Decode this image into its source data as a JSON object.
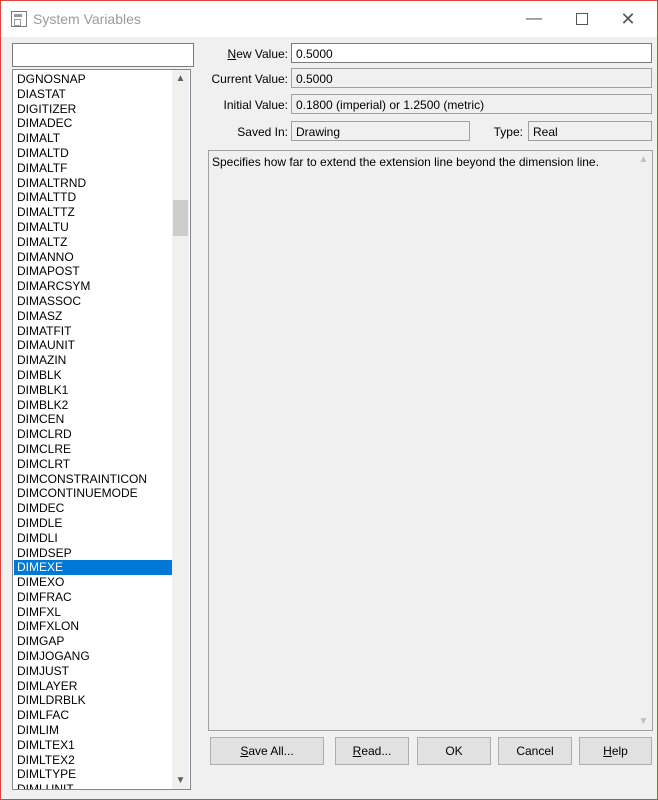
{
  "window": {
    "title": "System Variables"
  },
  "titlebar": {
    "minimize": "—",
    "close": "✕"
  },
  "search": {
    "value": ""
  },
  "list": {
    "items": [
      "DGNOSNAP",
      "DIASTAT",
      "DIGITIZER",
      "DIMADEC",
      "DIMALT",
      "DIMALTD",
      "DIMALTF",
      "DIMALTRND",
      "DIMALTTD",
      "DIMALTTZ",
      "DIMALTU",
      "DIMALTZ",
      "DIMANNO",
      "DIMAPOST",
      "DIMARCSYM",
      "DIMASSOC",
      "DIMASZ",
      "DIMATFIT",
      "DIMAUNIT",
      "DIMAZIN",
      "DIMBLK",
      "DIMBLK1",
      "DIMBLK2",
      "DIMCEN",
      "DIMCLRD",
      "DIMCLRE",
      "DIMCLRT",
      "DIMCONSTRAINTICON",
      "DIMCONTINUEMODE",
      "DIMDEC",
      "DIMDLE",
      "DIMDLI",
      "DIMDSEP",
      "DIMEXE",
      "DIMEXO",
      "DIMFRAC",
      "DIMFXL",
      "DIMFXLON",
      "DIMGAP",
      "DIMJOGANG",
      "DIMJUST",
      "DIMLAYER",
      "DIMLDRBLK",
      "DIMLFAC",
      "DIMLIM",
      "DIMLTEX1",
      "DIMLTEX2",
      "DIMLTYPE",
      "DIMLUNIT"
    ],
    "selected_index": 33
  },
  "form": {
    "new_value": {
      "label_underlined": "N",
      "label_rest": "ew Value:",
      "value": "0.5000"
    },
    "current_value": {
      "label": "Current Value:",
      "value": "0.5000"
    },
    "initial_value": {
      "label": "Initial Value:",
      "value": "0.1800 (imperial) or 1.2500 (metric)"
    },
    "saved_in": {
      "label": "Saved In:",
      "value": "Drawing"
    },
    "type": {
      "label": "Type:",
      "value": "Real"
    }
  },
  "description": "Specifies how far to extend the extension line beyond the dimension line.",
  "buttons": {
    "save_all": {
      "u": "S",
      "rest": "ave All..."
    },
    "read": {
      "u": "R",
      "rest": "ead..."
    },
    "ok": "OK",
    "cancel": "Cancel",
    "help": {
      "u": "H",
      "rest": "elp"
    }
  },
  "colors": {
    "selection": "#0078d7",
    "window_border": "#e0433a"
  },
  "icons": {
    "scroll_up": "▲",
    "scroll_down": "▼"
  }
}
